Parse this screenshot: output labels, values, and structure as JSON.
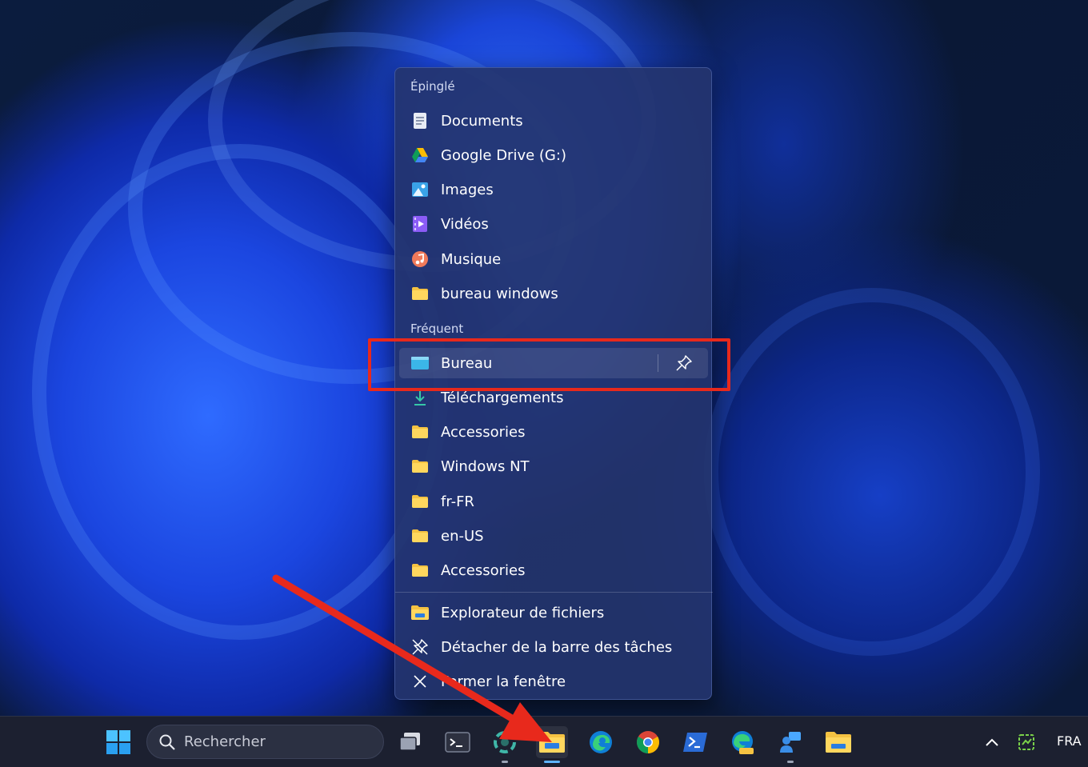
{
  "menu": {
    "pinned_label": "Épinglé",
    "pinned": [
      {
        "label": "Documents",
        "icon": "document-icon"
      },
      {
        "label": "Google Drive (G:)",
        "icon": "google-drive-icon"
      },
      {
        "label": "Images",
        "icon": "images-icon"
      },
      {
        "label": "Vidéos",
        "icon": "videos-icon"
      },
      {
        "label": "Musique",
        "icon": "music-icon"
      },
      {
        "label": "bureau windows",
        "icon": "folder-icon"
      }
    ],
    "frequent_label": "Fréquent",
    "frequent": [
      {
        "label": "Bureau",
        "icon": "desktop-icon"
      },
      {
        "label": "Téléchargements",
        "icon": "download-icon"
      },
      {
        "label": "Accessories",
        "icon": "folder-icon"
      },
      {
        "label": "Windows NT",
        "icon": "folder-icon"
      },
      {
        "label": "fr-FR",
        "icon": "folder-icon"
      },
      {
        "label": "en-US",
        "icon": "folder-icon"
      },
      {
        "label": "Accessories",
        "icon": "folder-icon"
      }
    ],
    "actions": [
      {
        "label": "Explorateur de fichiers",
        "icon": "file-explorer-icon"
      },
      {
        "label": "Détacher de la barre des tâches",
        "icon": "unpin-icon"
      },
      {
        "label": "Fermer la fenêtre",
        "icon": "close-icon"
      }
    ]
  },
  "taskbar": {
    "search_placeholder": "Rechercher",
    "language": "FRA"
  },
  "colors": {
    "highlight": "#e8291c",
    "folder": "#f5c242",
    "accent": "#5fb3ff"
  }
}
